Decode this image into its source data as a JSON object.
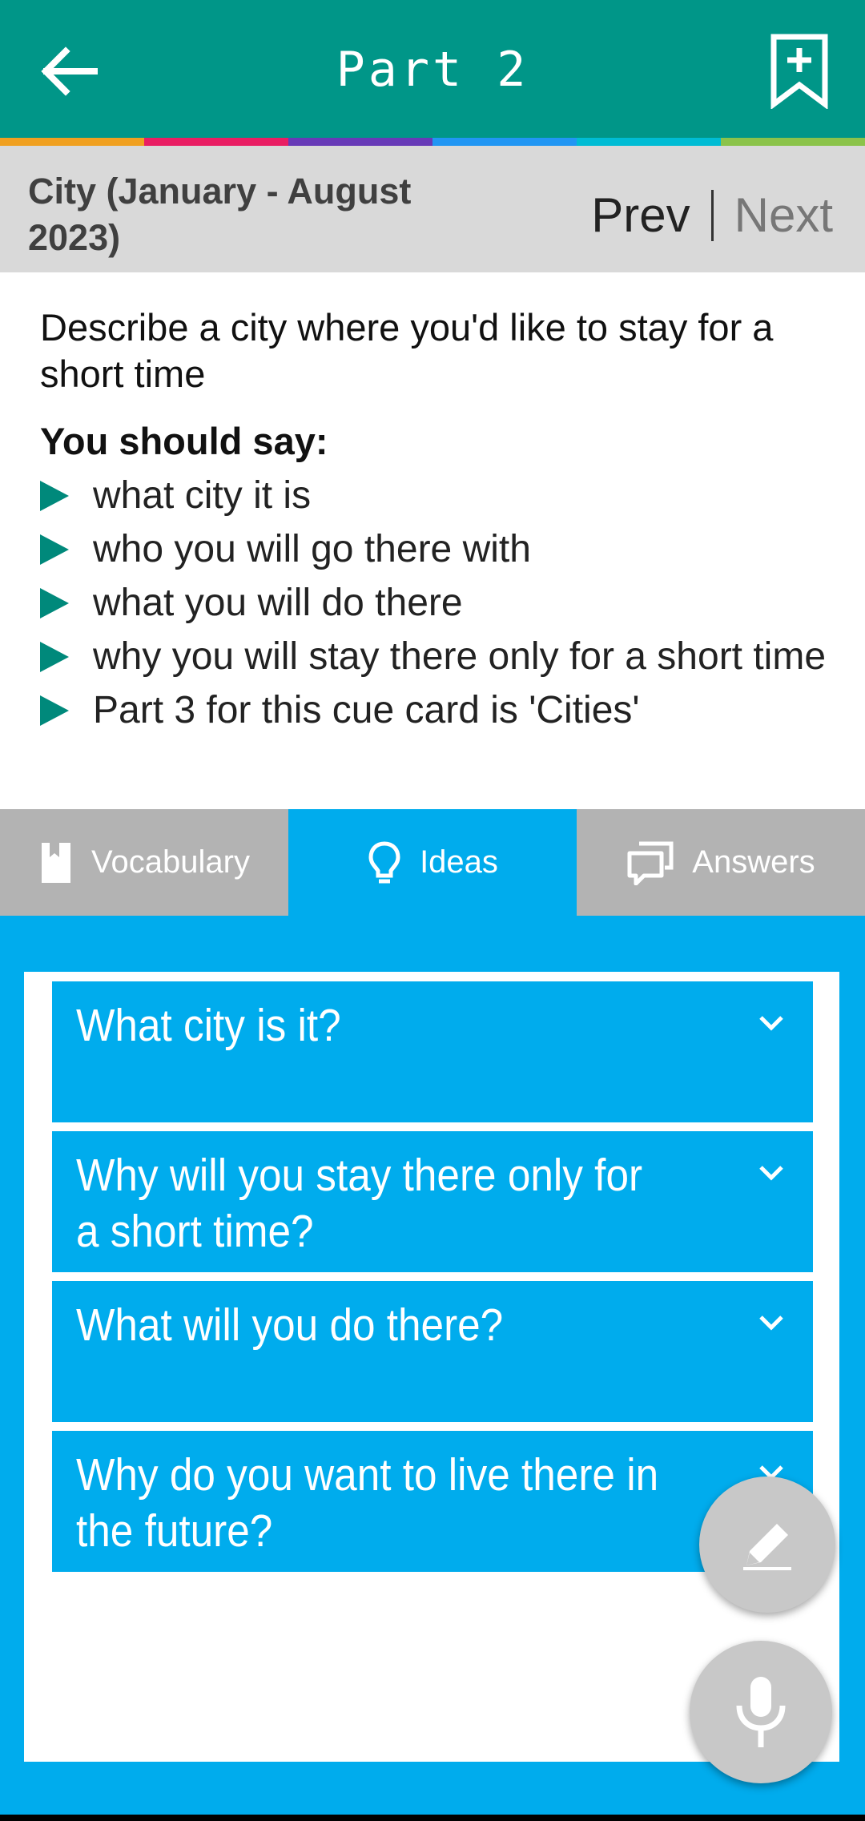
{
  "appbar": {
    "title": "Part 2",
    "back_icon": "arrow-left-icon",
    "bookmark_icon": "bookmark-add-icon"
  },
  "stripe_colors": [
    "#f0a020",
    "#e91e63",
    "#673ab7",
    "#2196f3",
    "#00bcd4",
    "#8bc34a"
  ],
  "subheader": {
    "topic": "City (January - August 2023)",
    "prev": "Prev",
    "next": "Next"
  },
  "cue_card": {
    "question": "Describe a city where you'd like to stay for a short time",
    "you_should_say": "You should say:",
    "points": [
      "what city it is",
      "who you will go there with",
      "what you will do there",
      "why you will stay there only for a short time",
      "Part 3 for this cue card is 'Cities'"
    ]
  },
  "tabs": [
    {
      "label": "Vocabulary",
      "icon": "book-icon",
      "active": false
    },
    {
      "label": "Ideas",
      "icon": "lightbulb-icon",
      "active": true
    },
    {
      "label": "Answers",
      "icon": "chat-bubbles-icon",
      "active": false
    }
  ],
  "ideas": [
    {
      "question": "What city is it?"
    },
    {
      "question": "Why will you stay there only for a short time?"
    },
    {
      "question": "What will you do there?"
    },
    {
      "question": "Why do you want to live there in the future?"
    }
  ],
  "fabs": {
    "edit_icon": "pencil-icon",
    "mic_icon": "microphone-icon"
  },
  "colors": {
    "appbar": "#009688",
    "accent": "#00aced",
    "bullet": "#00897b",
    "tab_inactive": "#b3b3b3"
  }
}
